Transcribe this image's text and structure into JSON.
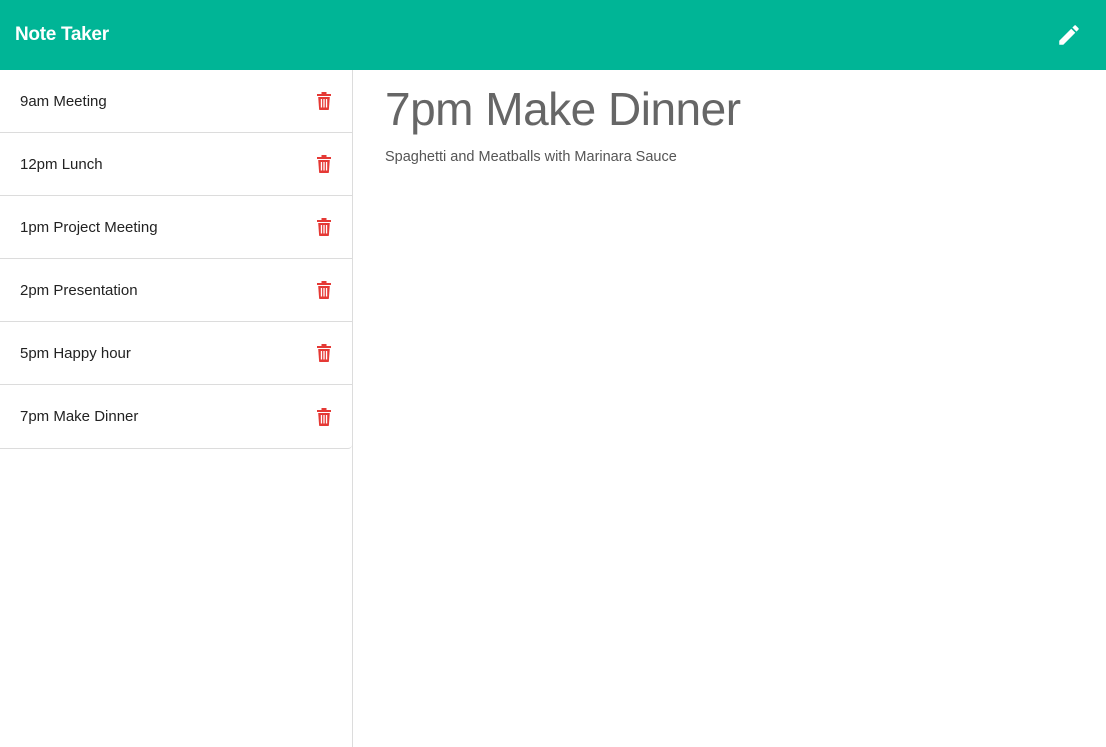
{
  "app": {
    "title": "Note Taker",
    "brand_color": "#00b596",
    "new_note_icon": "pencil-icon"
  },
  "sidebar": {
    "delete_icon": "trash-icon",
    "delete_color": "#e53935",
    "notes": [
      {
        "title": "9am Meeting"
      },
      {
        "title": "12pm Lunch"
      },
      {
        "title": "1pm Project Meeting"
      },
      {
        "title": "2pm Presentation"
      },
      {
        "title": "5pm Happy hour"
      },
      {
        "title": "7pm Make Dinner"
      }
    ]
  },
  "active_note": {
    "title": "7pm Make Dinner",
    "text": "Spaghetti and Meatballs with Marinara Sauce"
  }
}
